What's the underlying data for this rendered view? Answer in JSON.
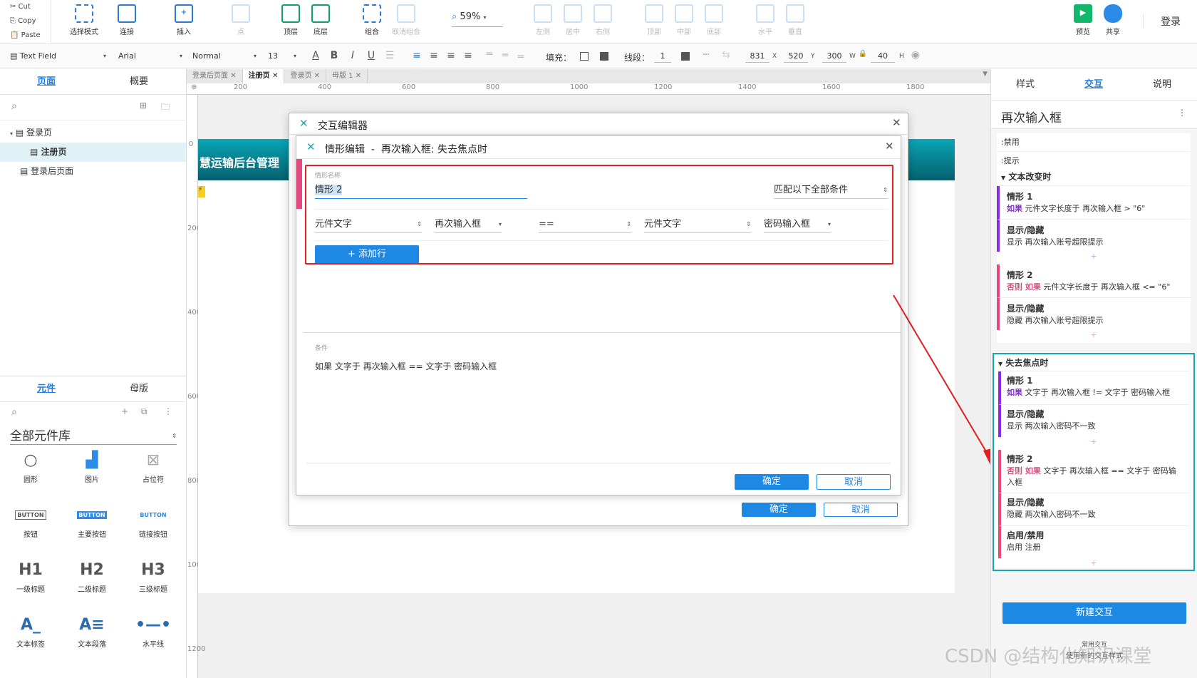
{
  "toolbar": {
    "clipboard": [
      "Cut",
      "Copy",
      "Paste"
    ],
    "tools": [
      {
        "label": "选择模式",
        "icon": "select-mode-icon"
      },
      {
        "label": "连接",
        "icon": "connect-icon"
      },
      {
        "label": "插入",
        "icon": "insert-icon"
      },
      {
        "label": "点",
        "icon": "point-icon"
      },
      {
        "label": "顶层",
        "icon": "bring-front-icon"
      },
      {
        "label": "底层",
        "icon": "send-back-icon"
      },
      {
        "label": "组合",
        "icon": "group-icon"
      },
      {
        "label": "取消组合",
        "icon": "ungroup-icon"
      },
      {
        "label": "左侧",
        "icon": "align-left-icon"
      },
      {
        "label": "居中",
        "icon": "align-center-icon"
      },
      {
        "label": "右侧",
        "icon": "align-right-icon"
      },
      {
        "label": "顶部",
        "icon": "align-top-icon"
      },
      {
        "label": "中部",
        "icon": "align-middle-icon"
      },
      {
        "label": "底部",
        "icon": "align-bottom-icon"
      },
      {
        "label": "水平",
        "icon": "distribute-h-icon"
      },
      {
        "label": "垂直",
        "icon": "distribute-v-icon"
      }
    ],
    "zoom": "59%",
    "preview": "预览",
    "share": "共享",
    "login": "登录"
  },
  "format": {
    "widget_type": "Text Field",
    "font": "Arial",
    "style": "Normal",
    "size": "13",
    "fill_label": "填充：",
    "line_label": "线段：",
    "line_value": "1",
    "x": "831",
    "x_label": "X",
    "y": "520",
    "y_label": "Y",
    "w": "300",
    "w_label": "W",
    "h": "40",
    "h_label": "H"
  },
  "left": {
    "tab_pages": "页面",
    "tab_outline": "概要",
    "pages": [
      "登录页",
      "注册页",
      "登录后页面"
    ],
    "tab_widgets": "元件",
    "tab_masters": "母版",
    "library": "全部元件库",
    "components": [
      "圆形",
      "图片",
      "占位符",
      "按钮",
      "主要按钮",
      "链接按钮",
      "一级标题",
      "二级标题",
      "三级标题",
      "文本标签",
      "文本段落",
      "水平线"
    ],
    "heading_glyphs": [
      "H1",
      "H2",
      "H3"
    ]
  },
  "doc_tabs": [
    "登录后页面",
    "注册页",
    "登录页",
    "母版 1"
  ],
  "ruler_h": [
    "200",
    "400",
    "600",
    "800",
    "1000",
    "1200",
    "1400",
    "1600",
    "1800"
  ],
  "ruler_v": [
    "0",
    "200",
    "400",
    "600",
    "800",
    "1000",
    "1200"
  ],
  "page_banner": "慧运输后台管理",
  "outer_dialog": {
    "title": "交互编辑器",
    "ok": "确定",
    "cancel": "取消"
  },
  "case_dialog": {
    "title": "情形编辑",
    "subtitle": "再次输入框: 失去焦点时",
    "name_label": "情形名称",
    "name_value": "情形 2",
    "match": "匹配以下全部条件",
    "cond_left_type": "元件文字",
    "cond_left_target": "再次输入框",
    "operator": "==",
    "cond_right_type": "元件文字",
    "cond_right_target": "密码输入框",
    "add_row": "+ 添加行",
    "cond_section": "条件",
    "cond_text": "如果 文字于 再次输入框 == 文字于 密码输入框",
    "ok": "确定",
    "cancel": "取消"
  },
  "right": {
    "tab_style": "样式",
    "tab_interact": "交互",
    "tab_notes": "说明",
    "widget_name": "再次输入框",
    "props": [
      ":禁用",
      ":提示"
    ],
    "events": [
      {
        "title": "文本改变时",
        "cases": [
          {
            "name": "情形 1",
            "kw": "如果",
            "cond": " 元件文字长度于 再次输入框 > \"6\"",
            "style": "purple",
            "actions": [
              {
                "name": "显示/隐藏",
                "detail": "显示 再次输入账号超限提示"
              }
            ]
          },
          {
            "name": "情形 2",
            "kw": "否则 如果",
            "cond": " 元件文字长度于 再次输入框 <= \"6\"",
            "style": "pink",
            "actions": [
              {
                "name": "显示/隐藏",
                "detail": "隐藏 再次输入账号超限提示"
              }
            ]
          }
        ]
      },
      {
        "title": "失去焦点时",
        "cases": [
          {
            "name": "情形 1",
            "kw": "如果",
            "cond": " 文字于 再次输入框 != 文字于 密码输入框",
            "style": "purple",
            "actions": [
              {
                "name": "显示/隐藏",
                "detail": "显示 两次输入密码不一致"
              }
            ]
          },
          {
            "name": "情形 2",
            "kw": "否则 如果",
            "cond": " 文字于 再次输入框 == 文字于 密码输入框",
            "style": "pink",
            "actions": [
              {
                "name": "显示/隐藏",
                "detail": "隐藏 两次输入密码不一致"
              },
              {
                "name": "启用/禁用",
                "detail": "启用 注册"
              }
            ]
          }
        ]
      }
    ],
    "new_interaction": "新建交互",
    "common_label": "常用交互",
    "common_sub": "使用新的交互样式"
  },
  "watermark": "CSDN @结构化知识课堂",
  "colors": {
    "accent": "#1e88e5",
    "highlight": "#e02020",
    "teal": "#1aa7b5"
  }
}
